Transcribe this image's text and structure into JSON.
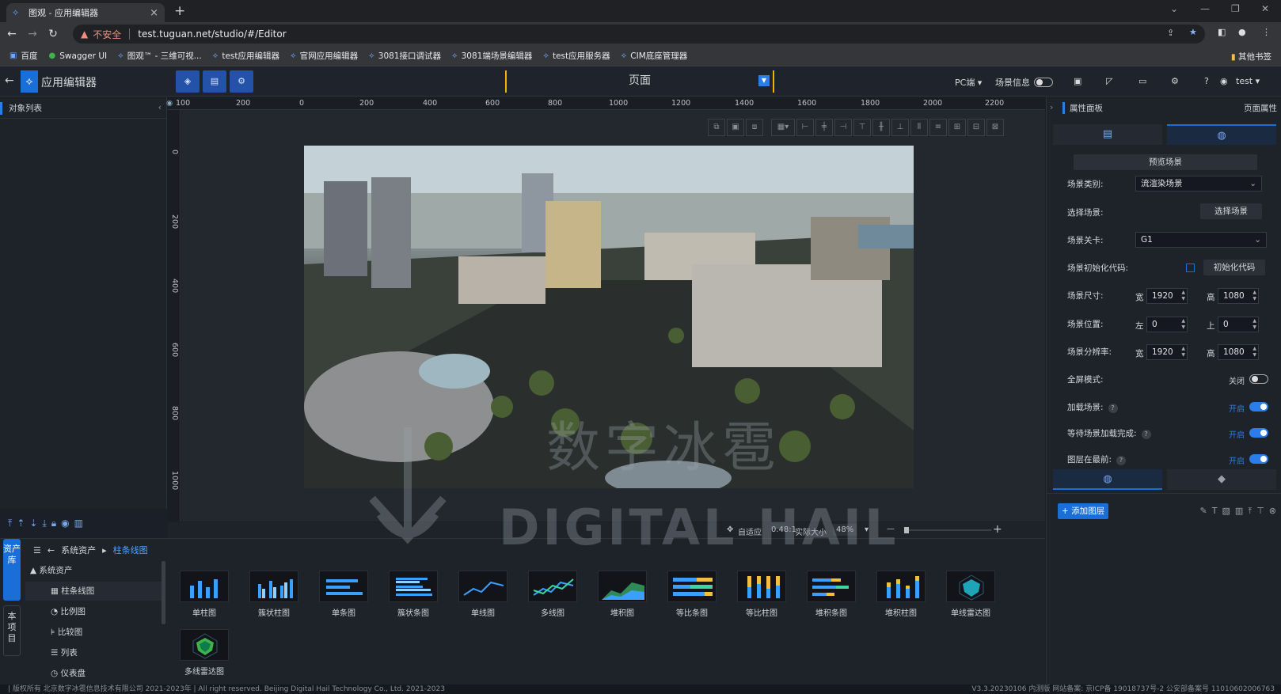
{
  "browser": {
    "tab_title": "图观 - 应用编辑器",
    "close": "×",
    "new_tab": "+",
    "insecure_label": "不安全",
    "url": "test.tuguan.net/studio/#/Editor",
    "bookmarks": [
      "百度",
      "Swagger UI",
      "图观™ - 三维可视...",
      "test应用编辑器",
      "官网应用编辑器",
      "3081接口调试器",
      "3081端场景编辑器",
      "test应用服务器",
      "CIM底座管理器"
    ],
    "other_bookmarks": "其他书签"
  },
  "header": {
    "title": "应用编辑器",
    "page_selector": "页面",
    "platform": "PC端 ▾",
    "scene_info": "场景信息",
    "user": "test ▾"
  },
  "left_panel": {
    "title": "对象列表"
  },
  "rulers": {
    "top": [
      "100",
      "200",
      "0",
      "200",
      "400",
      "600",
      "800",
      "1000",
      "1200",
      "1400",
      "1600",
      "1800",
      "2000",
      "2200"
    ],
    "left": [
      "0",
      "200",
      "400",
      "600",
      "800",
      "1000"
    ]
  },
  "zoom_bar": {
    "fit": "自适应",
    "ratio": "0.48:1",
    "actual": "实际大小",
    "zoom": "48%",
    "minus": "—",
    "plus": "+"
  },
  "assets": {
    "tab_assets": "资产库",
    "tab_project": "本项目",
    "crumb_root": "系统资产",
    "crumb_current": "柱条线图",
    "tree": [
      {
        "label": "系统资产",
        "icon": "▲"
      },
      {
        "label": "柱条线图",
        "icon": "▦"
      },
      {
        "label": "比例图",
        "icon": "◔"
      },
      {
        "label": "比较图",
        "icon": "⊧"
      },
      {
        "label": "列表",
        "icon": "☰"
      },
      {
        "label": "仪表盘",
        "icon": "◷"
      }
    ],
    "items": [
      "单柱图",
      "簇状柱图",
      "单条图",
      "簇状条图",
      "单线图",
      "多线图",
      "堆积图",
      "等比条图",
      "等比柱图",
      "堆积条图",
      "堆积柱图",
      "单线雷达图",
      "多线雷达图"
    ]
  },
  "right_panel": {
    "title": "属性面板",
    "subtitle": "页面属性",
    "preview_button": "预览场景",
    "scene_type_label": "场景类别:",
    "scene_type_value": "流渲染场景",
    "select_scene_label": "选择场景:",
    "select_scene_button": "选择场景",
    "level_label": "场景关卡:",
    "level_value": "G1",
    "init_code_label": "场景初始化代码:",
    "init_code_button": "初始化代码",
    "size_label": "场景尺寸:",
    "position_label": "场景位置:",
    "resolution_label": "场景分辨率:",
    "width_short": "宽",
    "height_short": "高",
    "left_short": "左",
    "top_short": "上",
    "size_w": "1920",
    "size_h": "1080",
    "pos_l": "0",
    "pos_t": "0",
    "res_w": "1920",
    "res_h": "1080",
    "fullscreen_label": "全屏模式:",
    "fullscreen_value": "关闭",
    "load_scene_label": "加载场景:",
    "load_scene_value": "开启",
    "wait_load_label": "等待场景加载完成:",
    "wait_load_value": "开启",
    "layer_front_label": "图层在最前:",
    "layer_front_value": "开启",
    "help": "?",
    "add_layer": "添加图层"
  },
  "footer": {
    "left": "| 版权所有 北京数字冰雹信息技术有限公司 2021-2023年 | All right reserved. Beijing Digital Hail Technology Co., Ltd. 2021-2023",
    "right": "V3.3.20230106 内测版 网站备案: 京ICP备 19018737号-2 公安部备案号 11010602006763"
  },
  "watermark": {
    "cn": "数字冰雹",
    "en": "DIGITAL HAIL"
  },
  "colors": {
    "accent": "#1a6ed8",
    "switch_on": "#2b7de9",
    "page_border": "#f0b400"
  }
}
